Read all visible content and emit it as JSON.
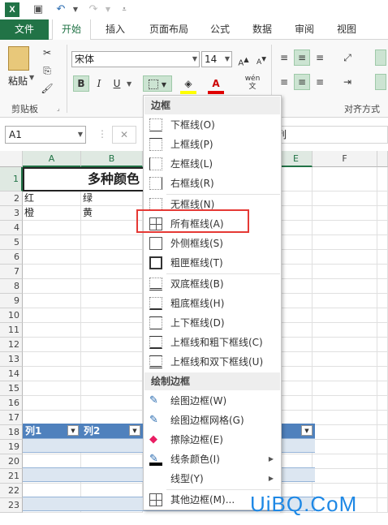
{
  "app": {
    "logo": "X"
  },
  "qat": {
    "undo": "↶",
    "redo": "↷"
  },
  "tabs": [
    "文件",
    "开始",
    "插入",
    "页面布局",
    "公式",
    "数据",
    "审阅",
    "视图"
  ],
  "ribbon": {
    "paste_label": "粘贴",
    "clipboard_label": "剪贴板",
    "font_name": "宋体",
    "font_size": "14",
    "bold": "B",
    "italic": "I",
    "underline": "U",
    "wen": "wén",
    "align_label": "对齐方式",
    "accent_color": "#217346"
  },
  "formula_bar": {
    "cell_ref": "A1",
    "cancel": "✕",
    "content_tail": "列"
  },
  "columns": [
    "A",
    "B",
    "E",
    "F"
  ],
  "rows": [
    "1",
    "2",
    "3",
    "4",
    "5",
    "6",
    "7",
    "8",
    "9",
    "10",
    "11",
    "12",
    "13",
    "14",
    "15",
    "16",
    "17",
    "18",
    "19",
    "20",
    "21",
    "22",
    "23"
  ],
  "cells": {
    "title": "多种颜色",
    "a2": "红",
    "b2": "绿",
    "a3": "橙",
    "b3": "黄"
  },
  "table_headers": [
    "列1",
    "列2"
  ],
  "menu": {
    "section_border": "边框",
    "section_draw": "绘制边框",
    "items": [
      "下框线(O)",
      "上框线(P)",
      "左框线(L)",
      "右框线(R)",
      "无框线(N)",
      "所有框线(A)",
      "外侧框线(S)",
      "粗匣框线(T)",
      "双底框线(B)",
      "粗底框线(H)",
      "上下框线(D)",
      "上框线和粗下框线(C)",
      "上框线和双下框线(U)"
    ],
    "draw_items": [
      "绘图边框(W)",
      "绘图边框网格(G)",
      "擦除边框(E)",
      "线条颜色(I)",
      "线型(Y)"
    ],
    "more": "其他边框(M)..."
  },
  "watermark": "UiBQ.CoM"
}
